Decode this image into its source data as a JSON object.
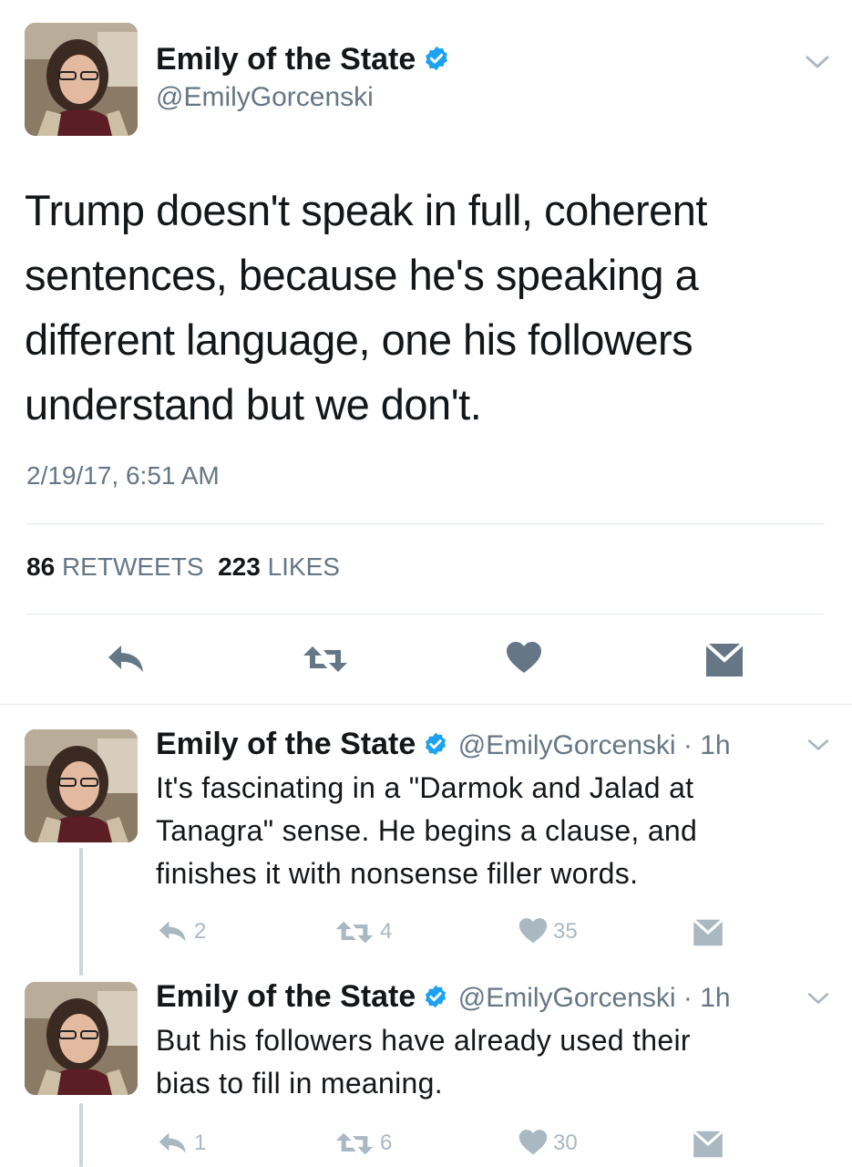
{
  "main_tweet": {
    "author_name": "Emily of the State",
    "author_handle": "@EmilyGorcenski",
    "text_lines": [
      "Trump doesn't speak in full, coherent",
      "sentences,  because he's speaking a",
      "different language, one his followers",
      "understand but we don't."
    ],
    "timestamp": "2/19/17, 6:51 AM",
    "retweets_count": "86",
    "retweets_label": "RETWEETS",
    "likes_count": "223",
    "likes_label": "LIKES"
  },
  "replies": [
    {
      "author_name": "Emily of the State",
      "handle_time": "@EmilyGorcenski · 1h",
      "text_lines": [
        "It's fascinating in a \"Darmok and Jalad at",
        "Tanagra\" sense. He begins a clause, and",
        "finishes it with nonsense filler words."
      ],
      "reply_count": "2",
      "retweet_count": "4",
      "like_count": "35"
    },
    {
      "author_name": "Emily of the State",
      "handle_time": "@EmilyGorcenski · 1h",
      "text_lines": [
        "But his followers have already used their",
        "bias to fill in meaning."
      ],
      "reply_count": "1",
      "retweet_count": "6",
      "like_count": "30"
    }
  ],
  "colors": {
    "text": "#14171a",
    "secondary": "#657786",
    "action_gray": "#aab8c2",
    "verified_blue": "#1da1f2",
    "divider": "#e1e8ed"
  },
  "icons": [
    "avatar",
    "verified-badge-icon",
    "chevron-down-icon",
    "reply-icon",
    "retweet-icon",
    "heart-icon",
    "direct-message-icon"
  ]
}
